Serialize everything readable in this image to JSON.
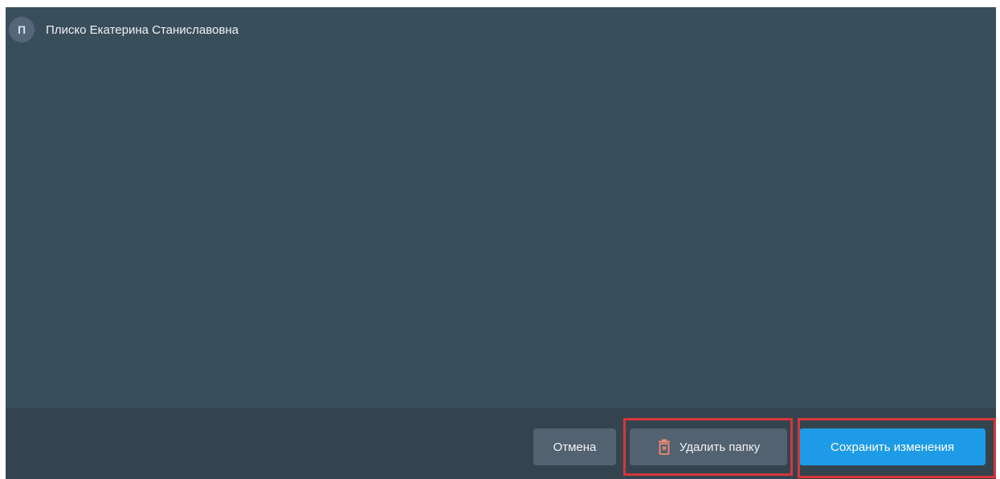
{
  "user": {
    "avatar_letter": "П",
    "name": "Плиско Екатерина Станиславовна"
  },
  "footer": {
    "cancel_label": "Отмена",
    "delete_label": "Удалить папку",
    "save_label": "Сохранить изменения"
  },
  "colors": {
    "panel": "#394e5b",
    "footer": "#34444f",
    "secondary_button": "#536270",
    "primary_button": "#1e9be6",
    "delete_icon": "#f08a72",
    "highlight": "#d8353a"
  },
  "icons": {
    "avatar": "avatar-letter",
    "delete": "trash-icon"
  }
}
